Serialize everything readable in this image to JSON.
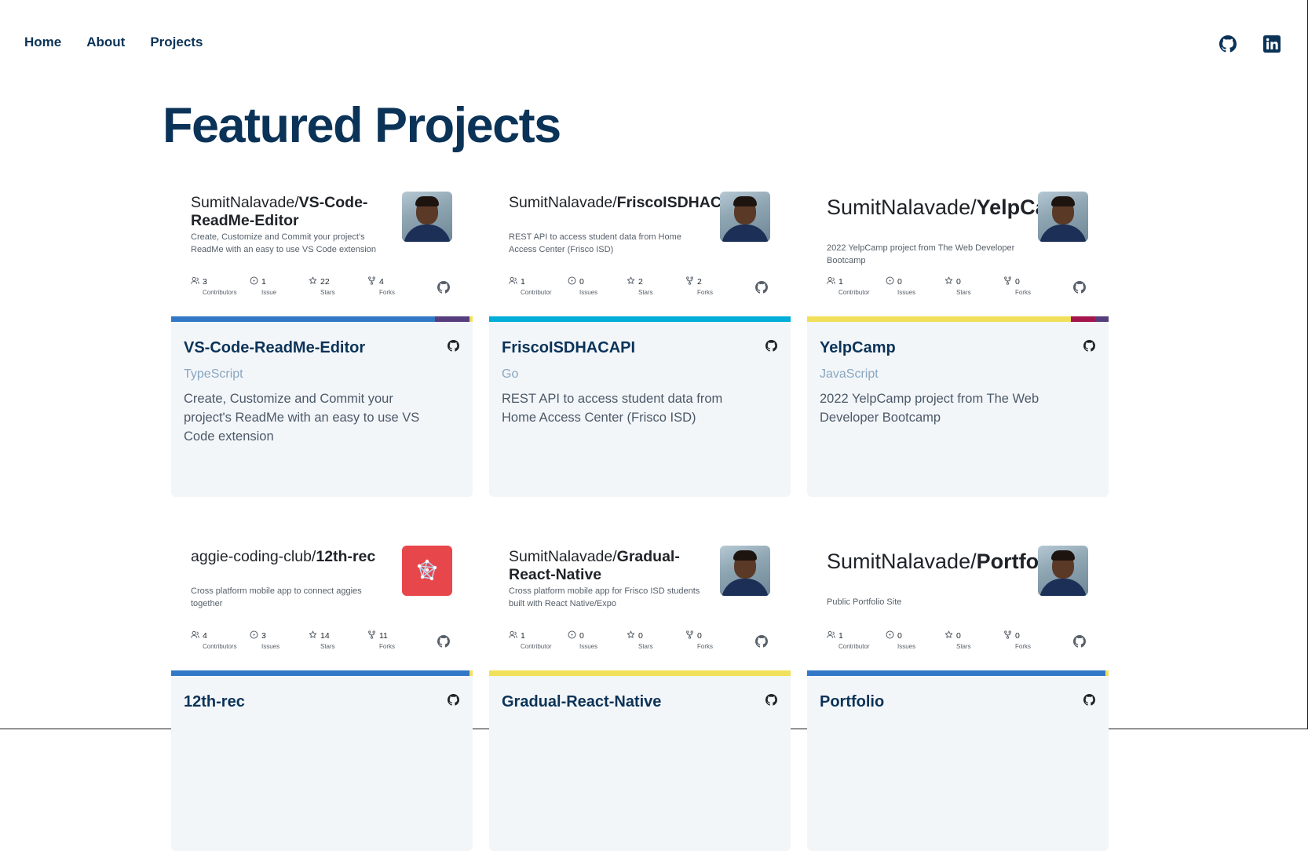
{
  "nav": {
    "home": "Home",
    "about": "About",
    "projects": "Projects"
  },
  "social": {
    "github_icon": "github-icon",
    "linkedin_icon": "linkedin-icon"
  },
  "page_title": "Featured Projects",
  "projects": [
    {
      "owner": "SumitNalavade/",
      "repo_title": "VS-Code-ReadMe-Editor",
      "card_desc": "Create, Customize and Commit your project's ReadMe with an easy to use VS Code extension",
      "stats": [
        {
          "value": "3",
          "label": "Contributors"
        },
        {
          "value": "1",
          "label": "Issue"
        },
        {
          "value": "22",
          "label": "Stars"
        },
        {
          "value": "4",
          "label": "Forks"
        }
      ],
      "name": "VS-Code-ReadMe-Editor",
      "language": "TypeScript",
      "description": "Create, Customize and Commit your project's ReadMe with an easy to use VS Code extension",
      "lang_colors": [
        "#3178c6",
        "#563d7c",
        "#f1e05a"
      ]
    },
    {
      "owner": "SumitNalavade/",
      "repo_title": "FriscoISDHACAPI",
      "card_desc": "REST API to access student data from Home Access Center (Frisco ISD)",
      "stats": [
        {
          "value": "1",
          "label": "Contributor"
        },
        {
          "value": "0",
          "label": "Issues"
        },
        {
          "value": "2",
          "label": "Stars"
        },
        {
          "value": "2",
          "label": "Forks"
        }
      ],
      "name": "FriscoISDHACAPI",
      "language": "Go",
      "description": "REST API to access student data from Home Access Center (Frisco ISD)",
      "lang_colors": [
        "#00add8"
      ]
    },
    {
      "owner": "SumitNalavade/",
      "repo_title": "YelpCamp",
      "card_desc": "2022 YelpCamp project from The Web Developer Bootcamp",
      "stats": [
        {
          "value": "1",
          "label": "Contributor"
        },
        {
          "value": "0",
          "label": "Issues"
        },
        {
          "value": "0",
          "label": "Stars"
        },
        {
          "value": "0",
          "label": "Forks"
        }
      ],
      "name": "YelpCamp",
      "language": "JavaScript",
      "description": "2022 YelpCamp project from The Web Developer Bootcamp",
      "lang_colors": [
        "#f1e05a",
        "#a3154c",
        "#563d7c"
      ]
    },
    {
      "owner": "aggie-coding-club/",
      "repo_title": "12th-rec",
      "card_desc": "Cross platform mobile app to connect aggies together",
      "stats": [
        {
          "value": "4",
          "label": "Contributors"
        },
        {
          "value": "3",
          "label": "Issues"
        },
        {
          "value": "14",
          "label": "Stars"
        },
        {
          "value": "11",
          "label": "Forks"
        }
      ],
      "name": "12th-rec",
      "language": "",
      "description": "",
      "lang_colors": [
        "#3178c6",
        "#f1e05a"
      ]
    },
    {
      "owner": "SumitNalavade/",
      "repo_title": "Gradual-React-Native",
      "card_desc": "Cross platform mobile app for Frisco ISD students built with React Native/Expo",
      "stats": [
        {
          "value": "1",
          "label": "Contributor"
        },
        {
          "value": "0",
          "label": "Issues"
        },
        {
          "value": "0",
          "label": "Stars"
        },
        {
          "value": "0",
          "label": "Forks"
        }
      ],
      "name": "Gradual-React-Native",
      "language": "",
      "description": "",
      "lang_colors": [
        "#f1e05a"
      ]
    },
    {
      "owner": "SumitNalavade/",
      "repo_title": "Portfolio",
      "card_desc": "Public Portfolio Site",
      "stats": [
        {
          "value": "1",
          "label": "Contributor"
        },
        {
          "value": "0",
          "label": "Issues"
        },
        {
          "value": "0",
          "label": "Stars"
        },
        {
          "value": "0",
          "label": "Forks"
        }
      ],
      "name": "Portfolio",
      "language": "",
      "description": "",
      "lang_colors": [
        "#3178c6",
        "#f1e05a"
      ]
    }
  ]
}
